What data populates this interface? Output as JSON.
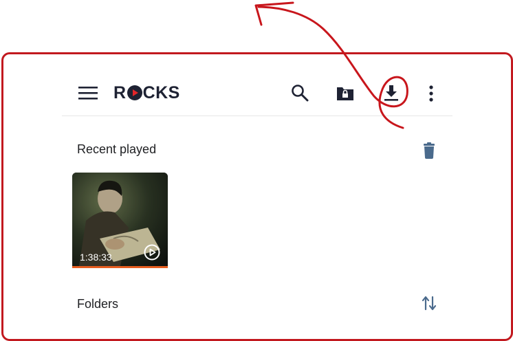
{
  "app": {
    "logo_text": [
      "R",
      "CKS"
    ]
  },
  "toolbar": {
    "menu": "menu-icon",
    "search": "search-icon",
    "private": "private-folder-icon",
    "download": "download-icon",
    "more": "more-vert-icon"
  },
  "sections": {
    "recent": {
      "title": "Recent played",
      "action": "trash-icon"
    },
    "folders": {
      "title": "Folders",
      "action": "sort-icon"
    }
  },
  "recent_items": [
    {
      "duration": "1:38:33",
      "progress_fraction": 1.0
    }
  ],
  "colors": {
    "frame": "#c2191f",
    "progress": "#e65c1e",
    "icon_blue": "#4a6a8c",
    "text": "#202124"
  }
}
